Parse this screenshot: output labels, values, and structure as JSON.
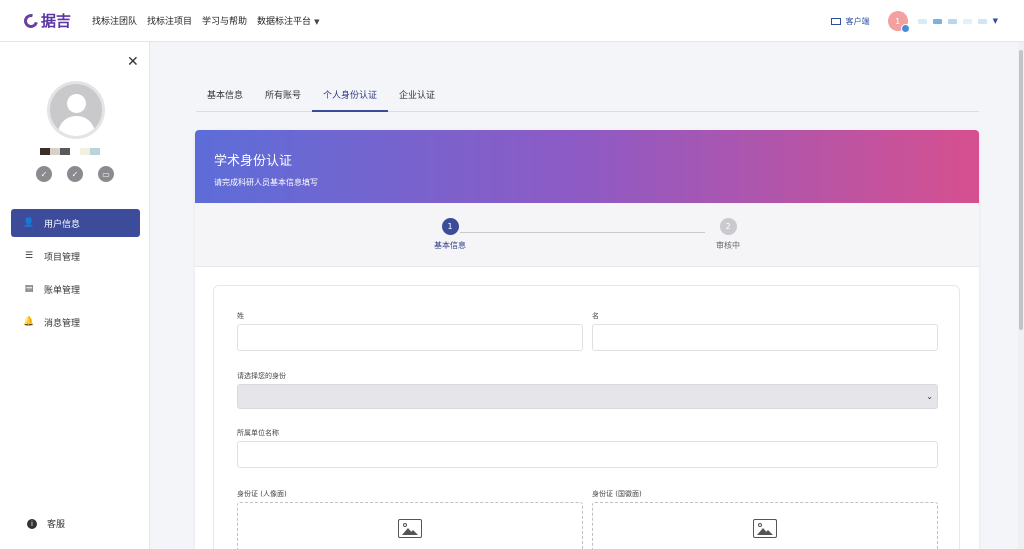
{
  "app": {
    "logo_text": "据吉"
  },
  "topnav": {
    "items": [
      "找标注团队",
      "找标注项目",
      "学习与帮助",
      "数据标注平台"
    ],
    "client_label": "客户端",
    "notification_count": "1"
  },
  "sidebar": {
    "menu": [
      {
        "label": "用户信息",
        "icon": "user-icon",
        "active": true
      },
      {
        "label": "项目管理",
        "icon": "list-icon",
        "active": false
      },
      {
        "label": "账单管理",
        "icon": "bill-icon",
        "active": false
      },
      {
        "label": "消息管理",
        "icon": "bell-icon",
        "active": false
      }
    ],
    "service_label": "客服"
  },
  "tabs": [
    {
      "label": "基本信息",
      "active": false
    },
    {
      "label": "所有账号",
      "active": false
    },
    {
      "label": "个人身份认证",
      "active": true
    },
    {
      "label": "企业认证",
      "active": false
    }
  ],
  "card": {
    "title": "学术身份认证",
    "subtitle": "请完成科研人员基本信息填写",
    "steps": [
      {
        "number": "1",
        "label": "基本信息",
        "active": true
      },
      {
        "number": "2",
        "label": "审核中",
        "active": false
      }
    ]
  },
  "form": {
    "last_name_label": "姓",
    "first_name_label": "名",
    "identity_label": "请选择您的身份",
    "org_label": "所属单位名称",
    "id_front_label": "身份证 (人像面)",
    "id_back_label": "身份证 (国徽面)"
  },
  "colors": {
    "primary": "#3c4c9a",
    "banner_start": "#5d6dd8",
    "banner_end": "#d6508f",
    "logo": "#5b35a5"
  }
}
